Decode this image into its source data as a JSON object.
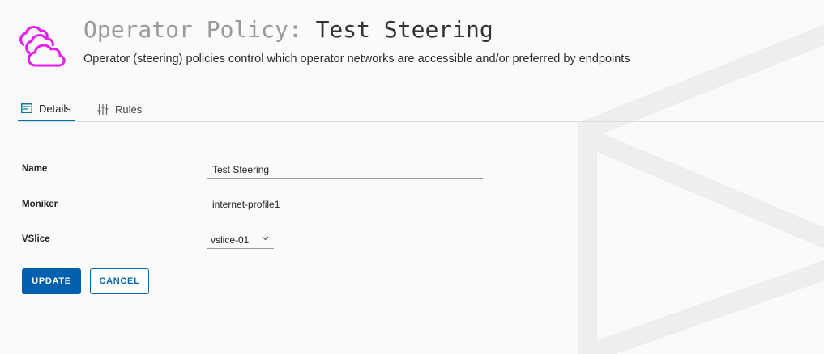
{
  "header": {
    "title_prefix": "Operator Policy:",
    "title_name": "Test Steering",
    "subtitle": "Operator (steering) policies control which operator networks are accessible and/or preferred by endpoints",
    "logo_icon": "clouds-icon",
    "accent_color": "#e81cf0"
  },
  "tabs": [
    {
      "label": "Details",
      "icon": "details-icon",
      "active": true
    },
    {
      "label": "Rules",
      "icon": "sliders-icon",
      "active": false
    }
  ],
  "form": {
    "name": {
      "label": "Name",
      "value": "Test Steering"
    },
    "moniker": {
      "label": "Moniker",
      "value": "internet-profile1"
    },
    "vslice": {
      "label": "VSlice",
      "value": "vslice-01"
    }
  },
  "buttons": {
    "update": "UPDATE",
    "cancel": "CANCEL"
  }
}
